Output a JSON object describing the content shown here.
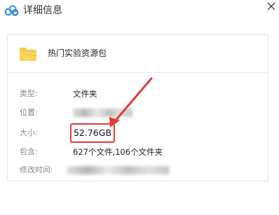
{
  "window": {
    "title": "详细信息",
    "icon": "cloud-icon",
    "close_icon": "close-icon"
  },
  "file": {
    "name": "热门实验资源包",
    "icon": "folder-icon",
    "folder_color": "#f7c84a"
  },
  "details": {
    "type_label": "类型:",
    "type_value": "文件夹",
    "location_label": "位置:",
    "size_label": "大小:",
    "size_value": "52.76GB",
    "contains_label": "包含:",
    "contains_value": "627个文件,106个文件夹",
    "modified_label": "修改时间:"
  },
  "annotation": {
    "highlight_color": "#e53935"
  }
}
